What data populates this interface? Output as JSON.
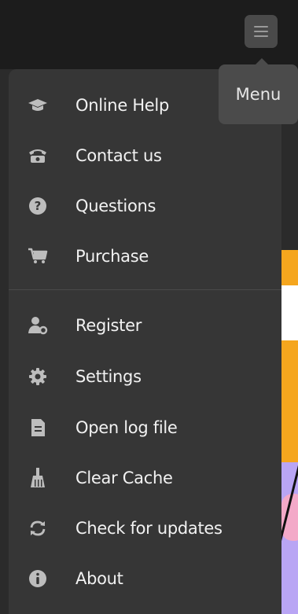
{
  "header": {
    "menu_button_icon": "hamburger-icon",
    "tooltip": "Menu"
  },
  "menu": {
    "items": [
      {
        "label": "Online Help",
        "icon": "graduation-cap-icon"
      },
      {
        "label": "Contact us",
        "icon": "telephone-icon"
      },
      {
        "label": "Questions",
        "icon": "question-circle-icon"
      },
      {
        "label": "Purchase",
        "icon": "shopping-cart-icon"
      },
      {
        "label": "Register",
        "icon": "user-key-icon"
      },
      {
        "label": "Settings",
        "icon": "gear-icon"
      },
      {
        "label": "Open log file",
        "icon": "document-icon"
      },
      {
        "label": "Clear Cache",
        "icon": "broom-icon"
      },
      {
        "label": "Check for updates",
        "icon": "refresh-icon"
      },
      {
        "label": "About",
        "icon": "info-circle-icon"
      }
    ]
  },
  "colors": {
    "topbar": "#1c1c1c",
    "dropdown": "#363636",
    "tooltip": "#4b4b4b",
    "text": "#f2f2f2",
    "icon": "#bdbdbd",
    "accent_orange": "#f5a61e",
    "accent_purple": "#b9a5f4"
  }
}
